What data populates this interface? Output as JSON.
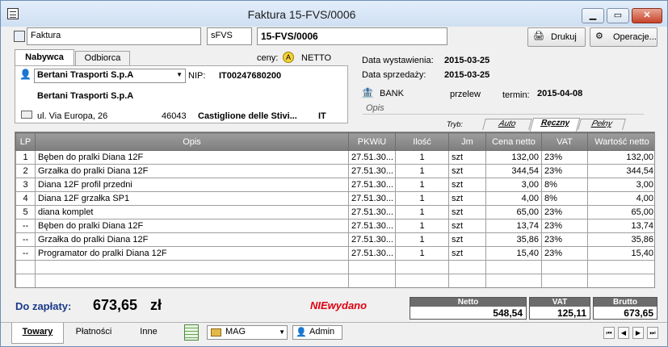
{
  "window": {
    "title": "Faktura 15-FVS/0006"
  },
  "header": {
    "doc_type": "Faktura",
    "series": "sFVS",
    "number": "15-FVS/0006",
    "print_label": "Drukuj",
    "operations_label": "Operacje..."
  },
  "party_tabs": {
    "buyer": "Nabywca",
    "recipient": "Odbiorca"
  },
  "prices": {
    "label": "ceny:",
    "badge": "A",
    "mode": "NETTO"
  },
  "buyer": {
    "name": "Bertani Trasporti S.p.A",
    "nip_label": "NIP:",
    "nip": "IT00247680200",
    "full_name": "Bertani Trasporti S.p.A",
    "street": "ul. Via Europa, 26",
    "postcode": "46043",
    "city": "Castiglione delle Stivi...",
    "country": "IT"
  },
  "dates": {
    "issue_label": "Data wystawienia:",
    "issue": "2015-03-25",
    "sale_label": "Data sprzedaży:",
    "sale": "2015-03-25"
  },
  "payment": {
    "bank": "BANK",
    "method": "przelew",
    "term_label": "termin:",
    "term": "2015-04-08"
  },
  "opis_label": "Opis",
  "mode_tabs": {
    "label": "Tryb:",
    "auto": "Auto",
    "manual": "Ręczny",
    "full": "Pełny"
  },
  "table": {
    "columns": [
      "LP",
      "Opis",
      "PKWiU",
      "Ilość",
      "Jm",
      "Cena netto",
      "VAT",
      "Wartość netto"
    ],
    "rows": [
      [
        "1",
        "Bęben do pralki Diana 12F",
        "27.51.30...",
        "1",
        "szt",
        "132,00",
        "23%",
        "132,00"
      ],
      [
        "2",
        "Grzałka do pralki Diana 12F",
        "27.51.30...",
        "1",
        "szt",
        "344,54",
        "23%",
        "344,54"
      ],
      [
        "3",
        "Diana 12F profil przedni",
        "27.51.30...",
        "1",
        "szt",
        "3,00",
        "8%",
        "3,00"
      ],
      [
        "4",
        "Diana 12F grzałka SP1",
        "27.51.30...",
        "1",
        "szt",
        "4,00",
        "8%",
        "4,00"
      ],
      [
        "5",
        "diana komplet",
        "27.51.30...",
        "1",
        "szt",
        "65,00",
        "23%",
        "65,00"
      ],
      [
        "--",
        "Bęben do pralki Diana 12F",
        "27.51.30...",
        "1",
        "szt",
        "13,74",
        "23%",
        "13,74"
      ],
      [
        "--",
        "Grzałka do pralki Diana 12F",
        "27.51.30...",
        "1",
        "szt",
        "35,86",
        "23%",
        "35,86"
      ],
      [
        "--",
        "Programator do pralki Diana 12F",
        "27.51.30...",
        "1",
        "szt",
        "15,40",
        "23%",
        "15,40"
      ],
      [
        "",
        "",
        "",
        "",
        "",
        "",
        "",
        ""
      ],
      [
        "",
        "",
        "",
        "",
        "",
        "",
        "",
        ""
      ]
    ]
  },
  "totals": {
    "due_label": "Do zapłaty:",
    "due": "673,65",
    "currency": "zł",
    "status": "NIEwydano",
    "netto_label": "Netto",
    "netto": "548,54",
    "vat_label": "VAT",
    "vat": "125,11",
    "brutto_label": "Brutto",
    "brutto": "673,65"
  },
  "bottom_tabs": {
    "goods": "Towary",
    "payments": "Płatności",
    "other": "Inne"
  },
  "warehouse": "MAG",
  "user": "Admin",
  "colors": {
    "status_red": "#e0000f",
    "title_blue": "#1b3a8a"
  }
}
